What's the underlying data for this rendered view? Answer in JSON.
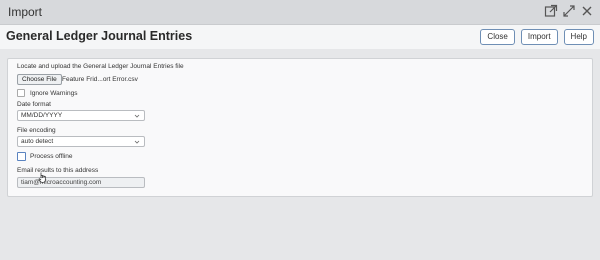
{
  "window": {
    "title": "Import",
    "icons": [
      "external-link-icon",
      "expand-icon",
      "close-icon"
    ]
  },
  "header": {
    "title": "General Ledger Journal Entries",
    "buttons": {
      "close": "Close",
      "import": "Import",
      "help": "Help"
    }
  },
  "form": {
    "upload_label": "Locate and upload the General Ledger Journal Entries file",
    "choose_file_label": "Choose File",
    "file_name": "Feature Frid...ort Error.csv",
    "ignore_warnings_label": "Ignore Warnings",
    "ignore_warnings_checked": false,
    "date_format_label": "Date format",
    "date_format_value": "MM/DD/YYYY",
    "file_encoding_label": "File encoding",
    "file_encoding_value": "auto detect",
    "process_offline_label": "Process offline",
    "process_offline_checked": false,
    "email_label": "Email results to this address",
    "email_value": "tiam@microaccounting.com"
  },
  "colors": {
    "button_border": "#6f8fb5",
    "titlebar_bg": "#d7d9dc",
    "page_bg": "#e6e7e9"
  }
}
